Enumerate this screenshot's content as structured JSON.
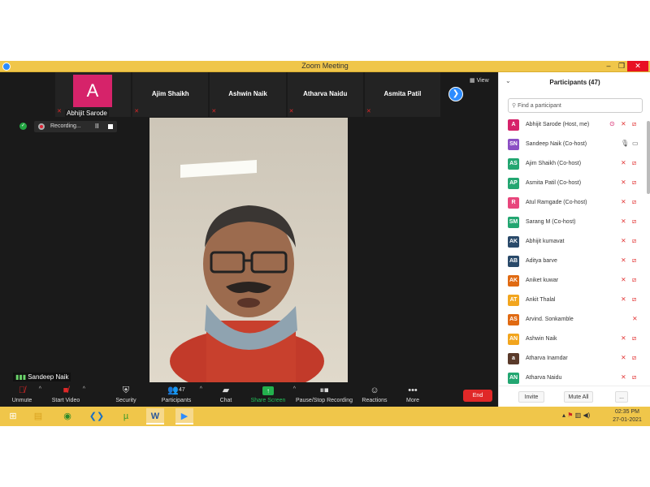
{
  "window": {
    "title": "Zoom Meeting",
    "minimize": "–",
    "maximize": "❐",
    "close": "✕"
  },
  "gallery": {
    "tiles": [
      {
        "avatar_letter": "A",
        "label": "Abhijit Sarode",
        "avatar_color": "#d6236a"
      },
      {
        "name": "Ajim Shaikh"
      },
      {
        "name": "Ashwin Naik"
      },
      {
        "name": "Atharva Naidu"
      },
      {
        "name": "Asmita Patil"
      }
    ],
    "view_label": "View",
    "next_icon": "chevron-right-icon"
  },
  "recording": {
    "label": "Recording...",
    "pause": "II"
  },
  "speaker": {
    "name": "Sandeep Naik"
  },
  "toolbar": {
    "unmute": "Unmute",
    "start_video": "Start Video",
    "security": "Security",
    "participants": "Participants",
    "participants_count": "47",
    "chat": "Chat",
    "share_screen": "Share Screen",
    "pause_stop_recording": "Pause/Stop Recording",
    "reactions": "Reactions",
    "more": "More",
    "end": "End"
  },
  "panel": {
    "title": "Participants (47)",
    "search_placeholder": "Find a participant",
    "participants": [
      {
        "initials": "A",
        "name": "Abhijit Sarode (Host, me)",
        "color": "#d6236a",
        "host": true
      },
      {
        "initials": "SN",
        "name": "Sandeep Naik (Co-host)",
        "color": "#8b4fc4",
        "unmuted": true
      },
      {
        "initials": "AS",
        "name": "Ajim Shaikh (Co-host)",
        "color": "#23a671"
      },
      {
        "initials": "AP",
        "name": "Asmita Patil (Co-host)",
        "color": "#23a671"
      },
      {
        "initials": "R",
        "name": "Atul Ramgade (Co-host)",
        "color": "#e8467c"
      },
      {
        "initials": "SM",
        "name": "Sarang M (Co-host)",
        "color": "#23a671"
      },
      {
        "initials": "AK",
        "name": "Abhijit  kumavat",
        "color": "#2a4a6a"
      },
      {
        "initials": "AB",
        "name": "Aditya barve",
        "color": "#2a4a6a"
      },
      {
        "initials": "AK",
        "name": "Aniket kuwar",
        "color": "#e06a12"
      },
      {
        "initials": "AT",
        "name": "Ankit Thalal",
        "color": "#f2a51e"
      },
      {
        "initials": "AS",
        "name": "Arvind. Sonkamble",
        "color": "#e06a12",
        "no_camera": true
      },
      {
        "initials": "AN",
        "name": "Ashwin Naik",
        "color": "#f2a51e"
      },
      {
        "initials": "a",
        "name": "Atharva Inamdar",
        "color": "#5a3a2a"
      },
      {
        "initials": "AN",
        "name": "Atharva Naidu",
        "color": "#23a671"
      }
    ],
    "invite": "Invite",
    "mute_all": "Mute All",
    "more": "..."
  },
  "taskbar": {
    "apps": [
      "windows-start-icon",
      "file-explorer-icon",
      "chrome-icon",
      "vscode-icon",
      "utorrent-icon",
      "word-icon",
      "zoom-icon"
    ],
    "time": "02:35 PM",
    "date": "27-01-2021"
  }
}
